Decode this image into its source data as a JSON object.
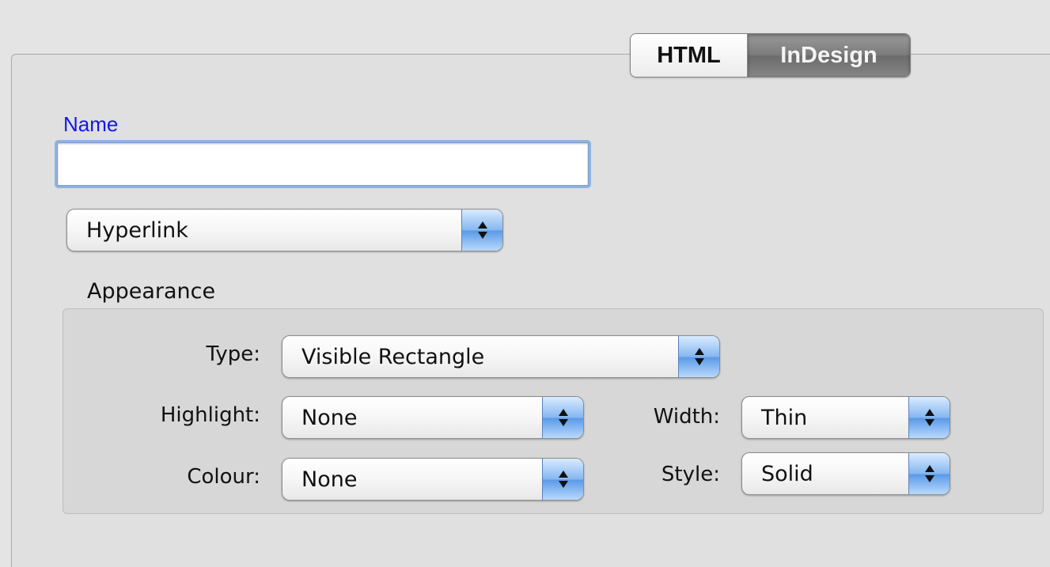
{
  "tabs": {
    "items": [
      {
        "label": "HTML",
        "selected": false
      },
      {
        "label": "InDesign",
        "selected": true
      }
    ]
  },
  "name": {
    "label": "Name",
    "value": ""
  },
  "link_type": {
    "selected": "Hyperlink"
  },
  "appearance": {
    "title": "Appearance",
    "type": {
      "label": "Type:",
      "value": "Visible Rectangle"
    },
    "highlight": {
      "label": "Highlight:",
      "value": "None"
    },
    "colour": {
      "label": "Colour:",
      "value": "None"
    },
    "width": {
      "label": "Width:",
      "value": "Thin"
    },
    "style": {
      "label": "Style:",
      "value": "Solid"
    }
  },
  "colors": {
    "label_accent": "#1515ee",
    "focus_ring": "#8fb4e0",
    "popup_arrow_blue": "#5a9ae8",
    "selected_tab": "#7c7c7c"
  },
  "icons": {
    "popup_arrows": "up-down-arrows-icon"
  }
}
